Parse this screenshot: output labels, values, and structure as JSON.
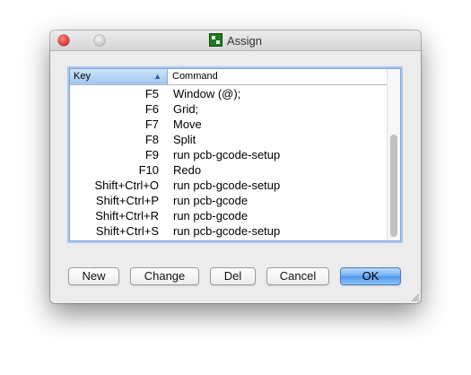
{
  "window": {
    "title": "Assign"
  },
  "table": {
    "headers": {
      "key": "Key",
      "command": "Command"
    },
    "rows": [
      {
        "key": "F5",
        "command": "Window (@);"
      },
      {
        "key": "F6",
        "command": "Grid;"
      },
      {
        "key": "F7",
        "command": "Move"
      },
      {
        "key": "F8",
        "command": "Split"
      },
      {
        "key": "F9",
        "command": "run pcb-gcode-setup"
      },
      {
        "key": "F10",
        "command": "Redo"
      },
      {
        "key": "Shift+Ctrl+O",
        "command": "run pcb-gcode-setup"
      },
      {
        "key": "Shift+Ctrl+P",
        "command": "run pcb-gcode"
      },
      {
        "key": "Shift+Ctrl+R",
        "command": "run pcb-gcode"
      },
      {
        "key": "Shift+Ctrl+S",
        "command": "run pcb-gcode-setup"
      }
    ]
  },
  "buttons": {
    "new": "New",
    "change": "Change",
    "del": "Del",
    "cancel": "Cancel",
    "ok": "OK"
  },
  "icons": {
    "title": "eagle-app-icon",
    "sort": "sort-ascending-icon",
    "close": "close-icon",
    "minimize": "minimize-icon",
    "resize": "resize-grip-icon"
  },
  "colors": {
    "selected_header": "#a9cdf2",
    "focus_ring": "#7fa6d8",
    "primary_button": "#6daaf0"
  }
}
